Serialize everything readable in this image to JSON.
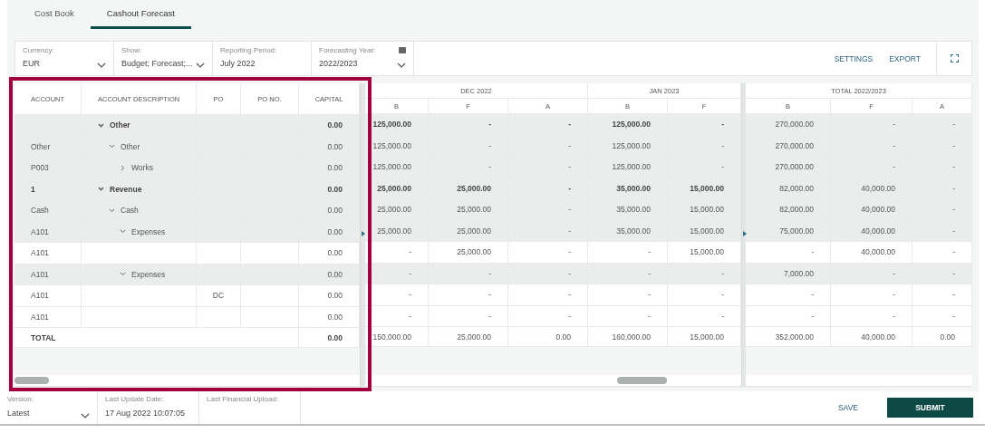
{
  "tabs": [
    {
      "label": "Cost Book",
      "selected": false
    },
    {
      "label": "Cashout Forecast",
      "selected": true
    }
  ],
  "filters": [
    {
      "label": "Currency:",
      "value": "EUR",
      "kind": "dropdown"
    },
    {
      "label": "Show:",
      "value": "Budget; Forecast;...",
      "kind": "dropdown"
    },
    {
      "label": "Reporting Period:",
      "value": "July 2022",
      "kind": "text"
    },
    {
      "label": "Forecasting Year:",
      "value": "2022/2023",
      "kind": "year"
    }
  ],
  "actions": [
    "SETTINGS",
    "EXPORT"
  ],
  "left_columns": [
    "ACCOUNT",
    "ACCOUNT DESCRIPTION",
    "PO",
    "PO NO.",
    "CAPITAL"
  ],
  "period_groups": [
    {
      "label": "DEC 2022",
      "columns": [
        "B",
        "F",
        "A"
      ]
    },
    {
      "label": "JAN 2023",
      "columns": [
        "B",
        "F"
      ]
    }
  ],
  "total_group": {
    "label": "TOTAL 2022/2023",
    "columns": [
      "B",
      "F",
      "A"
    ]
  },
  "rows": [
    {
      "account": "",
      "description": "Other",
      "capital": "0.00",
      "shaded": true,
      "expanded": true,
      "values": [
        "125,000.00",
        "-",
        "-",
        "125,000.00",
        "-",
        "270,000.00",
        "-",
        "-"
      ],
      "children": [
        {
          "account": "Other",
          "description": "Other",
          "capital": "0.00",
          "shaded": true,
          "expanded": true,
          "values": [
            "125,000.00",
            "-",
            "-",
            "125,000.00",
            "-",
            "270,000.00",
            "-",
            "-"
          ],
          "children": [
            {
              "account": "P003",
              "description": "Works",
              "capital": "0.00",
              "shaded": true,
              "expanded": false,
              "values": [
                "125,000.00",
                "-",
                "-",
                "125,000.00",
                "-",
                "270,000.00",
                "-",
                "-"
              ]
            }
          ]
        }
      ]
    },
    {
      "account": "1",
      "description": "Revenue",
      "capital": "0.00",
      "shaded": true,
      "expanded": true,
      "values": [
        "25,000.00",
        "25,000.00",
        "-",
        "35,000.00",
        "15,000.00",
        "82,000.00",
        "40,000.00",
        "-"
      ],
      "children": [
        {
          "account": "Cash",
          "description": "Cash",
          "capital": "0.00",
          "shaded": true,
          "expanded": true,
          "values": [
            "25,000.00",
            "25,000.00",
            "-",
            "35,000.00",
            "15,000.00",
            "82,000.00",
            "40,000.00",
            "-"
          ],
          "children": [
            {
              "account": "A101",
              "description": "Expenses",
              "capital": "0.00",
              "shaded": true,
              "expanded": true,
              "values": [
                "25,000.00",
                "25,000.00",
                "-",
                "35,000.00",
                "15,000.00",
                "75,000.00",
                "40,000.00",
                "-"
              ],
              "children": [
                {
                  "account": "A101",
                  "capital": "0.00",
                  "shaded": false,
                  "values": [
                    "-",
                    "25,000.00",
                    "-",
                    "-",
                    "15,000.00",
                    "-",
                    "40,000.00",
                    "-"
                  ]
                }
              ]
            },
            {
              "account": "A101",
              "description": "Expenses",
              "capital": "0.00",
              "shaded": true,
              "expanded": true,
              "values": [
                "-",
                "-",
                "-",
                "-",
                "-",
                "7,000.00",
                "-",
                "-"
              ],
              "children": [
                {
                  "account": "A101",
                  "po": "DC",
                  "capital": "0.00",
                  "shaded": false,
                  "values": [
                    "-",
                    "-",
                    "-",
                    "-",
                    "-",
                    "-",
                    "-",
                    "-"
                  ]
                },
                {
                  "account": "A101",
                  "capital": "0.00",
                  "shaded": false,
                  "values": [
                    "-",
                    "-",
                    "-",
                    "-",
                    "-",
                    "-",
                    "-",
                    "-"
                  ]
                }
              ]
            }
          ]
        }
      ]
    }
  ],
  "total": {
    "label": "TOTAL",
    "capital": "0.00",
    "values": [
      "150,000.00",
      "25,000.00",
      "0.00",
      "160,000.00",
      "15,000.00",
      "352,000.00",
      "40,000.00",
      "0.00"
    ]
  },
  "footer_fields": [
    {
      "label": "Version:",
      "value": "Latest",
      "kind": "dropdown"
    },
    {
      "label": "Last Update Date:",
      "value": "17 Aug 2022 10:07:05",
      "kind": "text"
    },
    {
      "label": "Last Financial Upload:",
      "kind": "text"
    }
  ],
  "save": "SAVE",
  "submit": "SUBMIT"
}
